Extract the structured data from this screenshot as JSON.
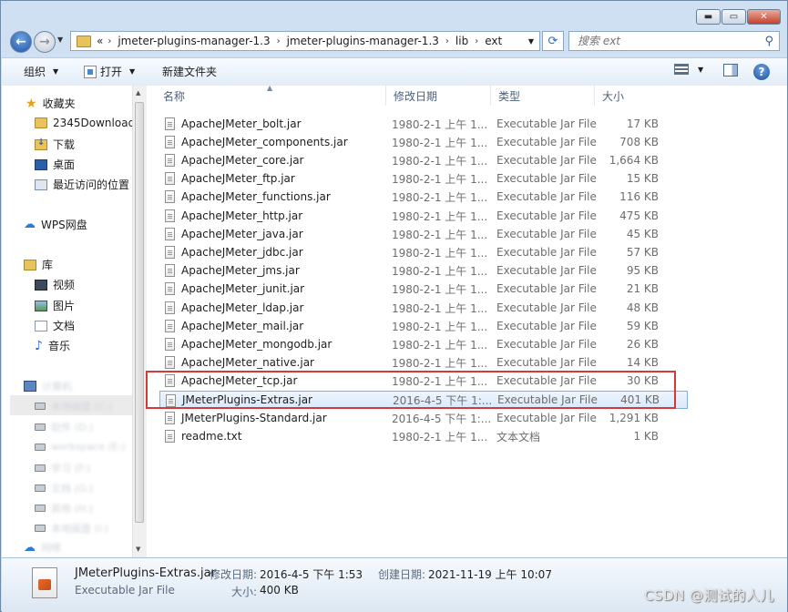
{
  "window": {
    "controls": {
      "minimize": "▬",
      "maximize": "▭",
      "close": "✕"
    }
  },
  "nav": {
    "overflow": "«",
    "breadcrumbs": [
      "jmeter-plugins-manager-1.3",
      "jmeter-plugins-manager-1.3",
      "lib",
      "ext"
    ],
    "separator": "›",
    "search_placeholder": "搜索 ext"
  },
  "toolbar": {
    "organize": "组织",
    "open": "打开",
    "new_folder": "新建文件夹"
  },
  "sidebar": {
    "favorites": {
      "label": "收藏夹",
      "items": [
        "2345Downloads",
        "下载",
        "桌面",
        "最近访问的位置"
      ]
    },
    "wps": "WPS网盘",
    "libraries": {
      "label": "库",
      "items": [
        "视频",
        "图片",
        "文档",
        "音乐"
      ]
    },
    "computer": {
      "label": "计算机",
      "items": [
        "本地磁盘 (C:)",
        "软件 (D:)",
        "workspace (E:)",
        "学习 (F:)",
        "文档 (G:)",
        "其他 (H:)",
        "本地磁盘 (I:)"
      ]
    },
    "network": "网络"
  },
  "columns": {
    "name": "名称",
    "date": "修改日期",
    "type": "类型",
    "size": "大小"
  },
  "files": [
    {
      "name": "ApacheJMeter_bolt.jar",
      "date": "1980-2-1 上午 1...",
      "type": "Executable Jar File",
      "size": "17 KB"
    },
    {
      "name": "ApacheJMeter_components.jar",
      "date": "1980-2-1 上午 1...",
      "type": "Executable Jar File",
      "size": "708 KB"
    },
    {
      "name": "ApacheJMeter_core.jar",
      "date": "1980-2-1 上午 1...",
      "type": "Executable Jar File",
      "size": "1,664 KB"
    },
    {
      "name": "ApacheJMeter_ftp.jar",
      "date": "1980-2-1 上午 1...",
      "type": "Executable Jar File",
      "size": "15 KB"
    },
    {
      "name": "ApacheJMeter_functions.jar",
      "date": "1980-2-1 上午 1...",
      "type": "Executable Jar File",
      "size": "116 KB"
    },
    {
      "name": "ApacheJMeter_http.jar",
      "date": "1980-2-1 上午 1...",
      "type": "Executable Jar File",
      "size": "475 KB"
    },
    {
      "name": "ApacheJMeter_java.jar",
      "date": "1980-2-1 上午 1...",
      "type": "Executable Jar File",
      "size": "45 KB"
    },
    {
      "name": "ApacheJMeter_jdbc.jar",
      "date": "1980-2-1 上午 1...",
      "type": "Executable Jar File",
      "size": "57 KB"
    },
    {
      "name": "ApacheJMeter_jms.jar",
      "date": "1980-2-1 上午 1...",
      "type": "Executable Jar File",
      "size": "95 KB"
    },
    {
      "name": "ApacheJMeter_junit.jar",
      "date": "1980-2-1 上午 1...",
      "type": "Executable Jar File",
      "size": "21 KB"
    },
    {
      "name": "ApacheJMeter_ldap.jar",
      "date": "1980-2-1 上午 1...",
      "type": "Executable Jar File",
      "size": "48 KB"
    },
    {
      "name": "ApacheJMeter_mail.jar",
      "date": "1980-2-1 上午 1...",
      "type": "Executable Jar File",
      "size": "59 KB"
    },
    {
      "name": "ApacheJMeter_mongodb.jar",
      "date": "1980-2-1 上午 1...",
      "type": "Executable Jar File",
      "size": "26 KB"
    },
    {
      "name": "ApacheJMeter_native.jar",
      "date": "1980-2-1 上午 1...",
      "type": "Executable Jar File",
      "size": "14 KB"
    },
    {
      "name": "ApacheJMeter_tcp.jar",
      "date": "1980-2-1 上午 1...",
      "type": "Executable Jar File",
      "size": "30 KB"
    },
    {
      "name": "JMeterPlugins-Extras.jar",
      "date": "2016-4-5 下午 1:...",
      "type": "Executable Jar File",
      "size": "401 KB"
    },
    {
      "name": "JMeterPlugins-Standard.jar",
      "date": "2016-4-5 下午 1:...",
      "type": "Executable Jar File",
      "size": "1,291 KB"
    },
    {
      "name": "readme.txt",
      "date": "1980-2-1 上午 1...",
      "type": "文本文档",
      "size": "1 KB"
    }
  ],
  "details": {
    "filename": "JMeterPlugins-Extras.jar",
    "filetype": "Executable Jar File",
    "modified_label": "修改日期:",
    "modified_value": "2016-4-5 下午 1:53",
    "size_label": "大小:",
    "size_value": "400 KB",
    "created_label": "创建日期:",
    "created_value": "2021-11-19 上午 10:07"
  },
  "watermark": "CSDN @测试的人儿",
  "colors": {
    "selection": "#d9e9fb",
    "highlight_border": "#d43a3a",
    "chrome": "#cfe0f2"
  }
}
